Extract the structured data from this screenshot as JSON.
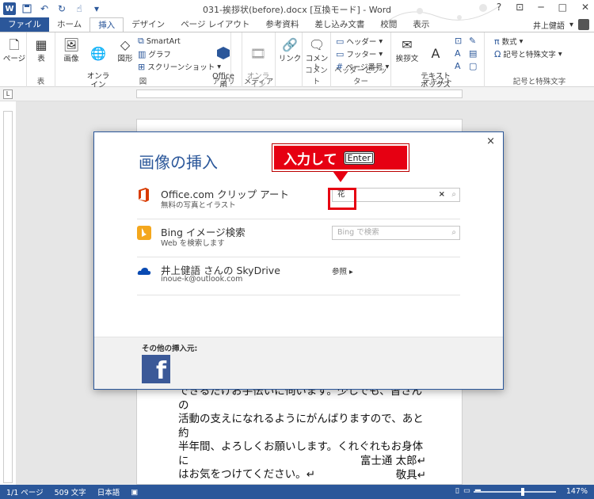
{
  "window": {
    "title": "031-挨拶状(before).docx [互換モード] - Word",
    "word_logo": "W",
    "user_name": "井上健語"
  },
  "tabs": [
    "ファイル",
    "ホーム",
    "挿入",
    "デザイン",
    "ページ レイアウト",
    "参考資料",
    "差し込み文書",
    "校閲",
    "表示"
  ],
  "active_tab": "挿入",
  "ribbon": {
    "pages": "ページ",
    "table": "表",
    "table_group": "表",
    "picture": "画像",
    "online_picture": "オンライン\n画像",
    "shapes": "図形",
    "smartart": "SmartArt",
    "chart": "グラフ",
    "screenshot": "スクリーンショット",
    "illustrations_group": "図",
    "apps": "Office 用\nアプリ",
    "apps_group": "アプリ",
    "online_video": "オンライン\nビデオ",
    "media_group": "メディア",
    "link": "リンク",
    "comment": "コメント",
    "comment_group": "コメント",
    "header": "ヘッダー",
    "footer": "フッター",
    "page_number": "ページ番号",
    "hf_group": "ヘッダーとフッター",
    "greeting": "挨拶文",
    "textbox": "テキスト\nボックス",
    "text_group": "テキスト",
    "equation": "数式",
    "symbol": "記号と特殊文字",
    "symbols_group": "記号と特殊文字"
  },
  "dialog": {
    "title": "画像の挿入",
    "close": "×",
    "sources": [
      {
        "title": "Office.com クリップ アート",
        "subtitle": "無料の写真とイラスト",
        "input_value": "花",
        "clear": "×"
      },
      {
        "title": "Bing イメージ検索",
        "subtitle": "Web を検索します",
        "input_placeholder": "Bing で検索"
      },
      {
        "title": "井上健語 さんの SkyDrive",
        "subtitle": "inoue-k@outlook.com",
        "action": "参照 ▸"
      }
    ],
    "footer_label": "その他の挿入元:",
    "facebook": "f"
  },
  "callout": {
    "text": "入力して",
    "key": "Enter"
  },
  "document": {
    "lines": [
      "できるだけお手伝いに伺います。少しでも、皆さんの",
      "活動の支えになれるようにがんばりますので、あと約",
      "半年間、よろしくお願いします。くれぐれもお身体に",
      "はお気をつけてください。↵",
      "↵"
    ],
    "sign_name": "富士通 太郎↵",
    "sign_closing": "敬具↵"
  },
  "status": {
    "page": "1/1 ページ",
    "words": "509 文字",
    "language": "日本語",
    "zoom": "147%",
    "zoom_fraction": 0.6
  },
  "colors": {
    "accent": "#2b579a",
    "callout": "#e60012",
    "facebook": "#3b5998",
    "office": "#d83b01",
    "bing": "#f4a71d",
    "skydrive": "#094ab2"
  }
}
